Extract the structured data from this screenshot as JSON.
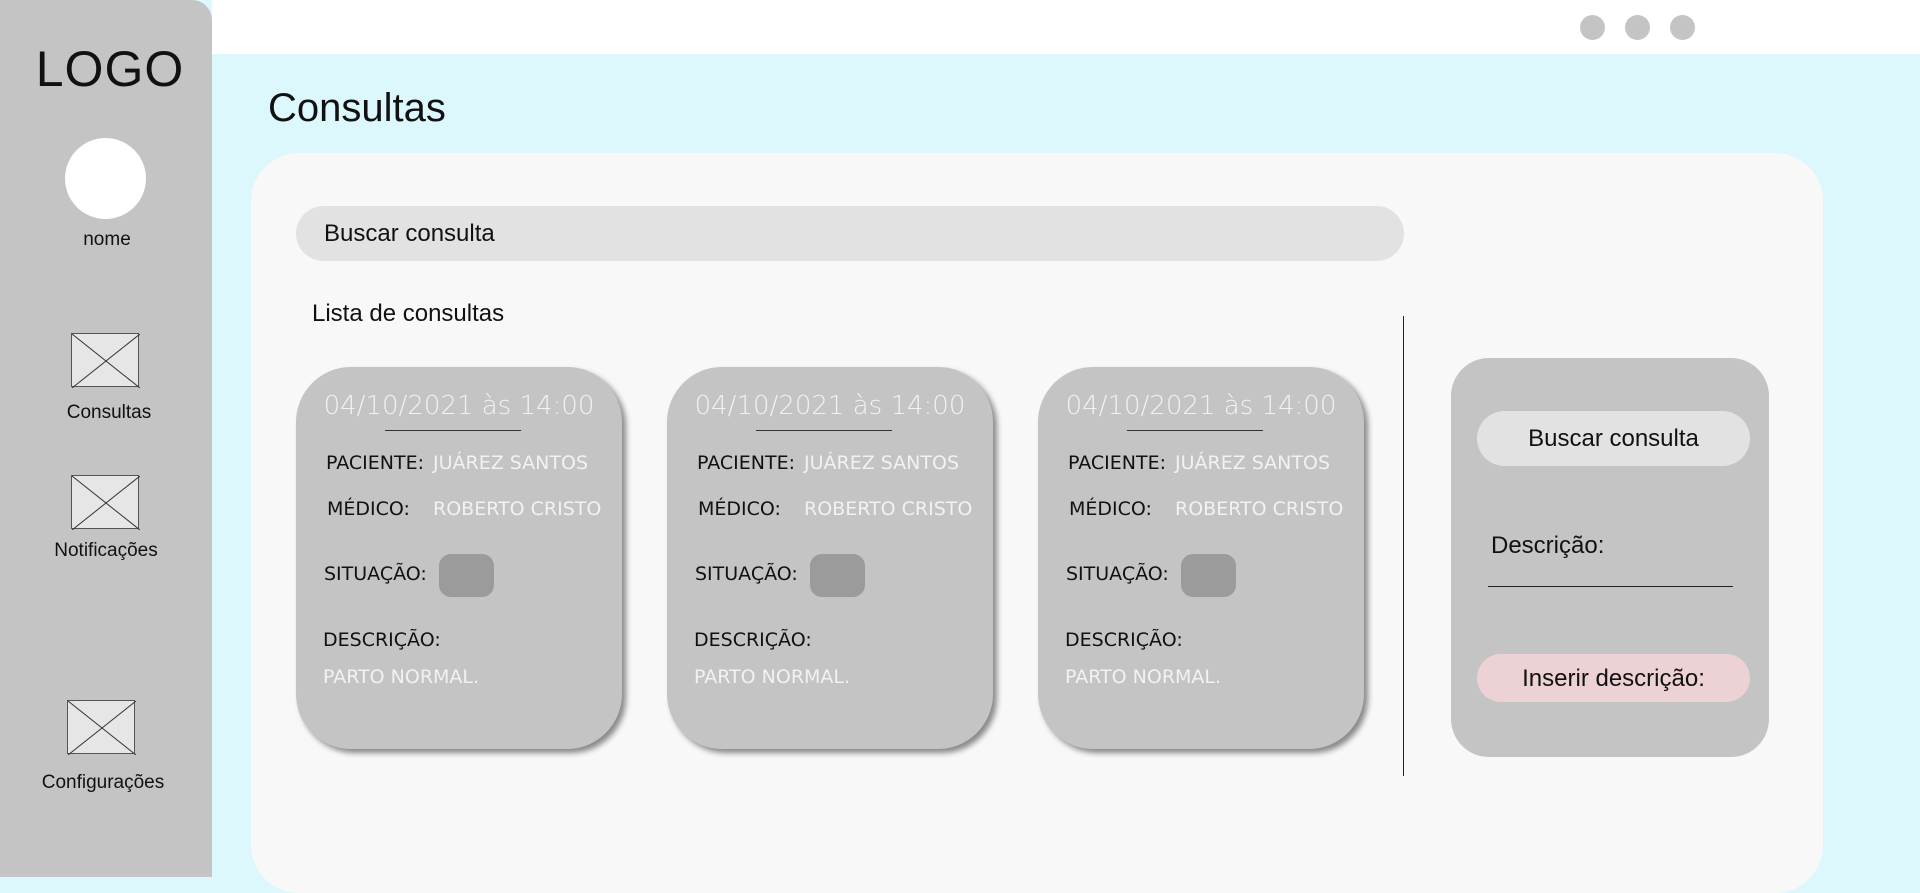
{
  "window": {
    "controls": [
      "window-dot",
      "window-dot",
      "window-dot"
    ]
  },
  "sidebar": {
    "logo": "LOGO",
    "user_name": "nome",
    "items": [
      {
        "label": "Consultas",
        "icon": "image-placeholder-icon"
      },
      {
        "label": "Notificações",
        "icon": "image-placeholder-icon"
      },
      {
        "label": "Configurações",
        "icon": "image-placeholder-icon"
      }
    ]
  },
  "page": {
    "title": "Consultas"
  },
  "search": {
    "label": "Buscar consulta"
  },
  "list": {
    "title": "Lista de consultas",
    "cards": [
      {
        "datetime": "04/10/2021 às 14:00",
        "patient_label": "PACIENTE:",
        "patient": "JUÁREZ SANTOS",
        "doctor_label": "MÉDICO:",
        "doctor": "ROBERTO CRISTO",
        "status_label": "SITUAÇÃO:",
        "description_label": "DESCRIÇÃO:",
        "description": "PARTO NORMAL."
      },
      {
        "datetime": "04/10/2021 às 14:00",
        "patient_label": "PACIENTE:",
        "patient": "JUÁREZ SANTOS",
        "doctor_label": "MÉDICO:",
        "doctor": "ROBERTO CRISTO",
        "status_label": "SITUAÇÃO:",
        "description_label": "DESCRIÇÃO:",
        "description": "PARTO NORMAL."
      },
      {
        "datetime": "04/10/2021 às 14:00",
        "patient_label": "PACIENTE:",
        "patient": "JUÁREZ SANTOS",
        "doctor_label": "MÉDICO:",
        "doctor": "ROBERTO CRISTO",
        "status_label": "SITUAÇÃO:",
        "description_label": "DESCRIÇÃO:",
        "description": "PARTO NORMAL."
      }
    ]
  },
  "panel": {
    "search_label": "Buscar consulta",
    "description_label": "Descrição:",
    "insert_label": "Inserir descrição:"
  },
  "colors": {
    "background": "#dcf8fc",
    "sidebar": "#c4c4c4",
    "content": "#f8f8f8",
    "search": "#e2e2e2",
    "insert_button": "#ecd2d4",
    "status": "#9b9b9b"
  }
}
